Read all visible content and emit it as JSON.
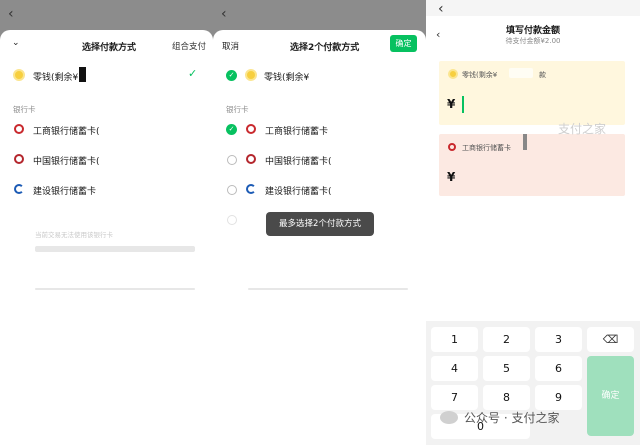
{
  "panel1": {
    "title": "选择付款方式",
    "right": "组合支付",
    "change": "零钱(剩余¥",
    "section": "银行卡",
    "banks": [
      "工商银行储蓄卡(",
      "中国银行储蓄卡(",
      "建设银行储蓄卡"
    ],
    "notice": "当前交易无法使用该银行卡"
  },
  "panel2": {
    "cancel": "取消",
    "title": "选择2个付款方式",
    "confirm": "确定",
    "change": "零钱(剩余¥",
    "section": "银行卡",
    "banks": [
      "工商银行储蓄卡",
      "中国银行储蓄卡(",
      "建设银行储蓄卡("
    ],
    "toast": "最多选择2个付款方式"
  },
  "panel3": {
    "title": "填写付款金额",
    "subtitle": "待支付金额¥2.00",
    "card1": "零钱(剩余¥",
    "card1_suffix": "款",
    "card2": "工商银行储蓄卡",
    "yen": "¥",
    "watermark": "支付之家",
    "keys": [
      "1",
      "2",
      "3",
      "4",
      "5",
      "6",
      "7",
      "8",
      "9",
      "0"
    ],
    "confirm": "确定"
  },
  "footer": {
    "text": "公众号 · 支付之家"
  },
  "colors": {
    "accent": "#07c160",
    "coin": "#f7cf3f",
    "card_yellow": "#fff7de",
    "card_pink": "#fce9e2"
  }
}
